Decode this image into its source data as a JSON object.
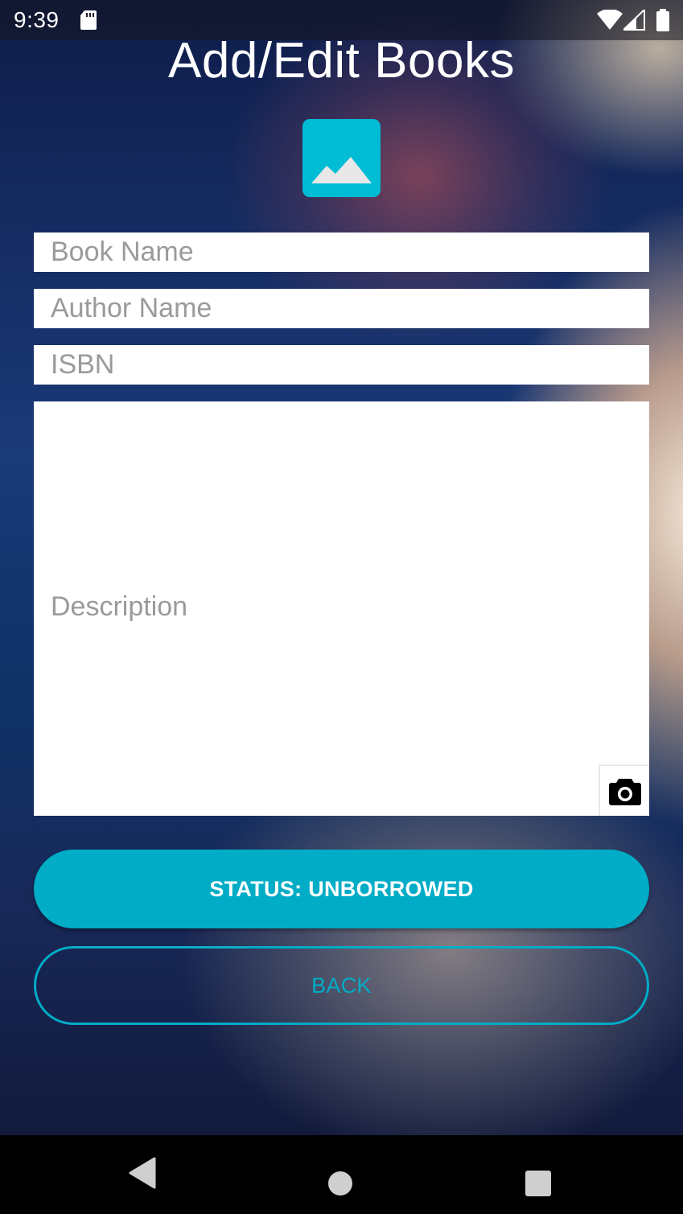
{
  "status_bar": {
    "time": "9:39",
    "icons": [
      "sd-card-icon",
      "wifi-icon",
      "signal-icon",
      "battery-icon"
    ]
  },
  "page": {
    "title": "Add/Edit Books",
    "image_picker_icon": "image-icon",
    "accent_color": "#00bcd4"
  },
  "form": {
    "book_name": {
      "value": "",
      "placeholder": "Book Name"
    },
    "author_name": {
      "value": "",
      "placeholder": "Author Name"
    },
    "isbn": {
      "value": "",
      "placeholder": "ISBN"
    },
    "description": {
      "value": "",
      "placeholder": "Description"
    },
    "camera_icon": "camera-icon"
  },
  "buttons": {
    "status_label": "STATUS: UNBORROWED",
    "back_label": "BACK",
    "button_color": "#00acc6"
  },
  "nav_bar": {
    "icons": [
      "back-triangle-icon",
      "home-circle-icon",
      "recents-square-icon"
    ]
  }
}
